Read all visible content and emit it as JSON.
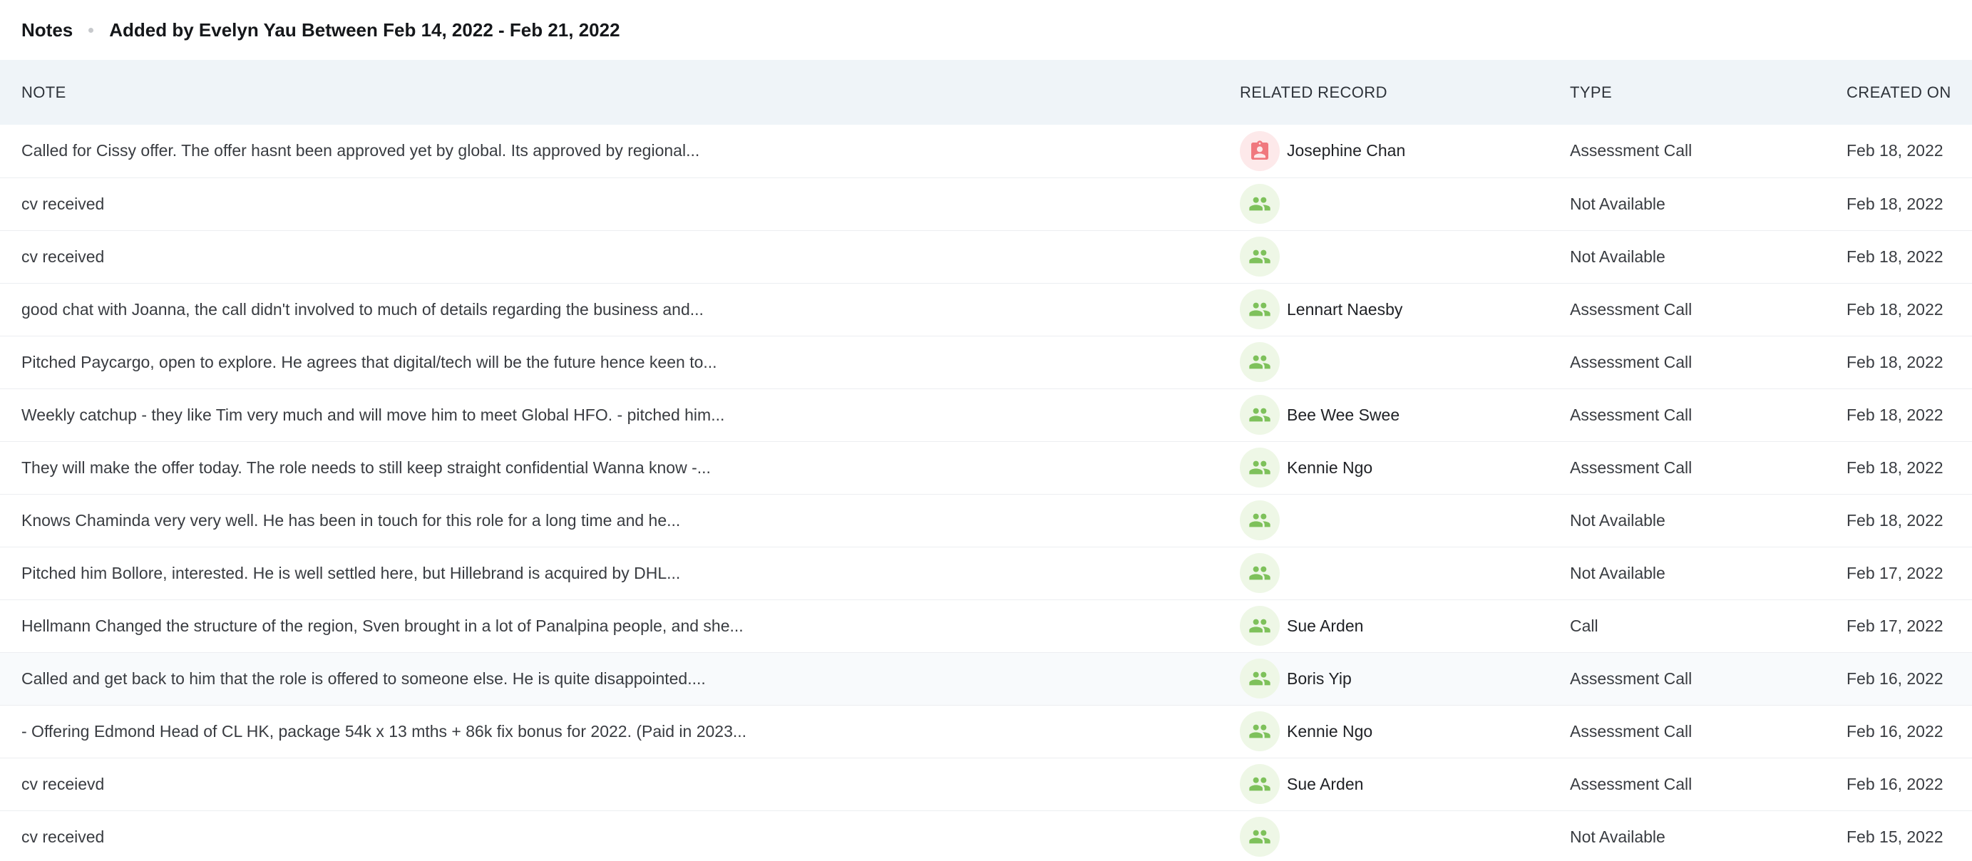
{
  "header": {
    "title": "Notes",
    "filter": "Added by Evelyn Yau Between Feb 14, 2022 - Feb 21, 2022"
  },
  "table": {
    "columns": {
      "note": "NOTE",
      "related": "RELATED RECORD",
      "type": "TYPE",
      "created": "CREATED ON"
    },
    "rows": [
      {
        "note": "Called for Cissy offer. The offer hasnt been approved yet by global. Its approved by regional...",
        "icon": "contact-card-icon",
        "related": "Josephine Chan",
        "type": "Assessment Call",
        "created": "Feb 18, 2022"
      },
      {
        "note": "cv received",
        "icon": "people-icon",
        "related": "",
        "type": "Not Available",
        "created": "Feb 18, 2022"
      },
      {
        "note": "cv received",
        "icon": "people-icon",
        "related": "",
        "type": "Not Available",
        "created": "Feb 18, 2022"
      },
      {
        "note": "good chat with Joanna, the call didn't involved to much of details regarding the business and...",
        "icon": "people-icon",
        "related": "Lennart Naesby",
        "type": "Assessment Call",
        "created": "Feb 18, 2022"
      },
      {
        "note": "Pitched Paycargo, open to explore. He agrees that digital/tech will be the future hence keen to...",
        "icon": "people-icon",
        "related": "",
        "type": "Assessment Call",
        "created": "Feb 18, 2022"
      },
      {
        "note": "Weekly catchup - they like Tim very much and will move him to meet Global HFO. - pitched him...",
        "icon": "people-icon",
        "related": "Bee Wee Swee",
        "type": "Assessment Call",
        "created": "Feb 18, 2022"
      },
      {
        "note": "They will make the offer today. The role needs to still keep straight confidential Wanna know -...",
        "icon": "people-icon",
        "related": "Kennie Ngo",
        "type": "Assessment Call",
        "created": "Feb 18, 2022"
      },
      {
        "note": "Knows Chaminda very very well. He has been in touch for this role for a long time and he...",
        "icon": "people-icon",
        "related": "",
        "type": "Not Available",
        "created": "Feb 18, 2022"
      },
      {
        "note": "Pitched him Bollore, interested. He is well settled here, but Hillebrand is acquired by DHL...",
        "icon": "people-icon",
        "related": "",
        "type": "Not Available",
        "created": "Feb 17, 2022"
      },
      {
        "note": "Hellmann Changed the structure of the region, Sven brought in a lot of Panalpina people, and she...",
        "icon": "people-icon",
        "related": "Sue Arden",
        "type": "Call",
        "created": "Feb 17, 2022"
      },
      {
        "note": "Called and get back to him that the role is offered to someone else. He is quite disappointed....",
        "icon": "people-icon",
        "related": "Boris Yip",
        "type": "Assessment Call",
        "created": "Feb 16, 2022"
      },
      {
        "note": "- Offering Edmond Head of CL HK, package 54k x 13 mths + 86k fix bonus for 2022. (Paid in 2023...",
        "icon": "people-icon",
        "related": "Kennie Ngo",
        "type": "Assessment Call",
        "created": "Feb 16, 2022"
      },
      {
        "note": "cv receievd",
        "icon": "people-icon",
        "related": "Sue Arden",
        "type": "Assessment Call",
        "created": "Feb 16, 2022"
      },
      {
        "note": "cv received",
        "icon": "people-icon",
        "related": "",
        "type": "Not Available",
        "created": "Feb 15, 2022"
      }
    ]
  },
  "colors": {
    "header_bg": "#eff4f8",
    "people_icon": "#7ec15b",
    "people_bg": "#eef7e6",
    "contact_icon": "#f0787e",
    "contact_bg": "#fde9ea"
  }
}
